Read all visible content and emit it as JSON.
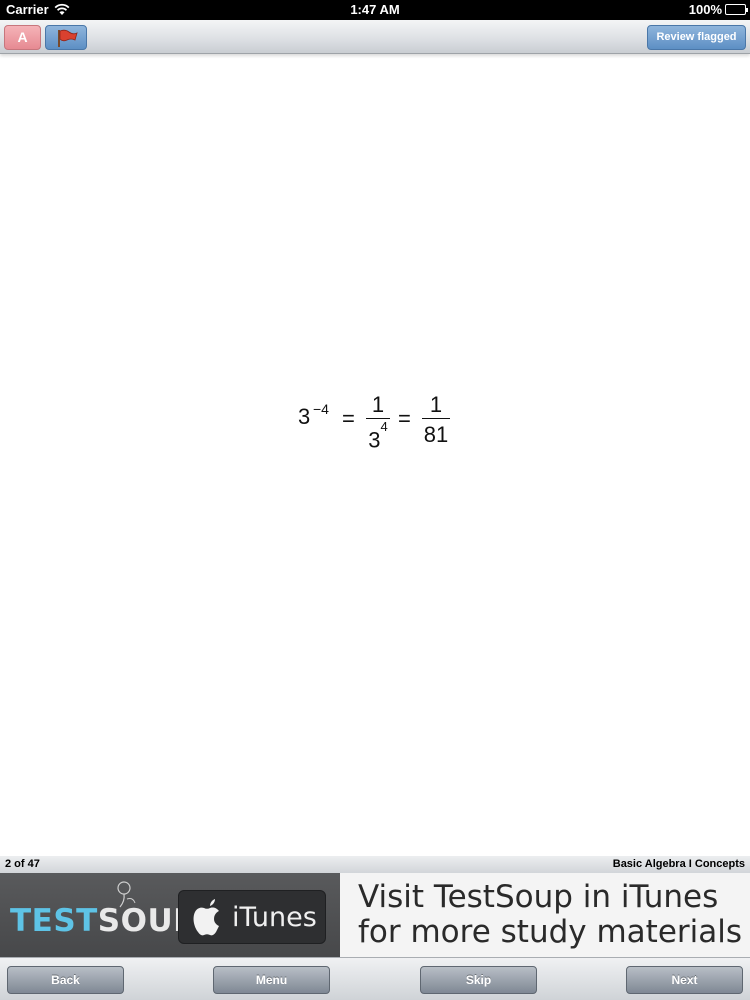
{
  "status_bar": {
    "carrier": "Carrier",
    "time": "1:47 AM",
    "battery": "100%"
  },
  "toolbar": {
    "answer_label": "A",
    "flag_icon": "flag-icon",
    "review_label": "Review flagged"
  },
  "equation": {
    "base": "3",
    "exponent": "−4",
    "equals_1": "=",
    "frac1_numerator": "1",
    "frac1_denominator_base": "3",
    "frac1_denominator_exponent": "4",
    "equals_2": "=",
    "frac2_numerator": "1",
    "frac2_denominator": "81"
  },
  "info_bar": {
    "progress": "2 of 47",
    "category": "Basic Algebra I Concepts"
  },
  "ad": {
    "logo_part1": "TEST",
    "logo_part2": "SOUP",
    "itunes_label": "iTunes",
    "line1": "Visit TestSoup in iTunes",
    "line2": "for more study materials"
  },
  "bottom_nav": {
    "back": "Back",
    "menu": "Menu",
    "skip": "Skip",
    "next": "Next"
  },
  "colors": {
    "answer_button": "#e68a92",
    "accent_button": "#5d8fc4",
    "logo_blue": "#5ec3e6",
    "nav_button": "#7f8894"
  }
}
